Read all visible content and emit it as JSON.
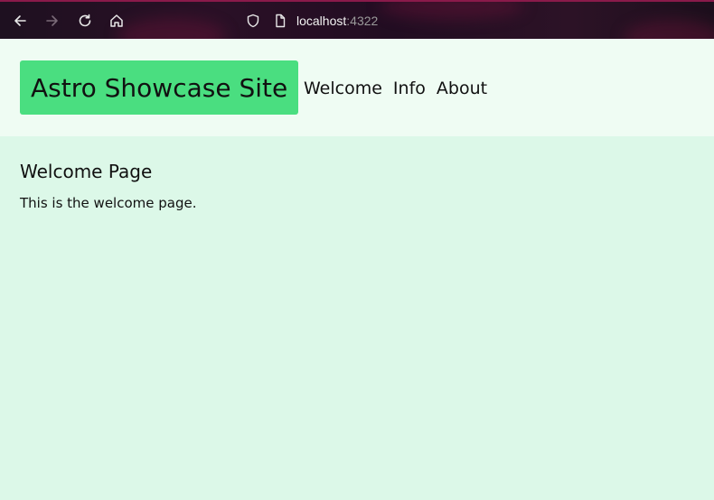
{
  "browser": {
    "url_host": "localhost",
    "url_port": ":4322",
    "icons": [
      "back-arrow-icon",
      "forward-arrow-icon",
      "reload-icon",
      "home-icon",
      "shield-icon",
      "page-icon"
    ],
    "theme_color": "#2a1026"
  },
  "header": {
    "site_title": "Astro Showcase Site",
    "title_bg": "#4ade80",
    "nav": [
      {
        "label": "Welcome"
      },
      {
        "label": "Info"
      },
      {
        "label": "About"
      }
    ]
  },
  "main": {
    "heading": "Welcome Page",
    "text": "This is the welcome page."
  },
  "colors": {
    "header_bg": "#effcf3",
    "page_bg": "#dcf8e8"
  }
}
